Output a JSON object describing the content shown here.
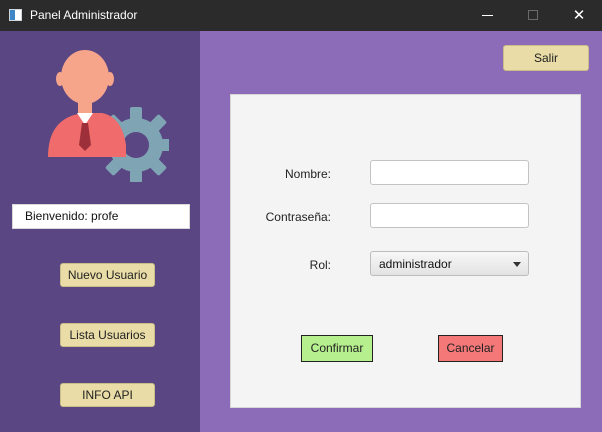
{
  "window": {
    "title": "Panel Administrador",
    "icons": {
      "app": "app-window-icon",
      "minimize": "minimize-icon",
      "maximize": "maximize-icon",
      "close": "close-icon"
    }
  },
  "colors": {
    "sidebar": "#5a4683",
    "main": "#8c6bb8",
    "panel": "#f4f4f4",
    "yellow_button": "#e9dca6",
    "confirm_button": "#b6f08e",
    "cancel_button": "#f57878"
  },
  "sidebar": {
    "avatar_icon": "admin-user-gear-icon",
    "welcome_text": "Bienvenido: profe",
    "buttons": [
      {
        "label": "Nuevo Usuario"
      },
      {
        "label": "Lista Usuarios"
      },
      {
        "label": "INFO API"
      }
    ]
  },
  "main": {
    "logout_label": "Salir",
    "form": {
      "nombre_label": "Nombre:",
      "nombre_value": "",
      "password_label": "Contraseña:",
      "password_value": "",
      "rol_label": "Rol:",
      "rol_selected": "administrador",
      "confirm_label": "Confirmar",
      "cancel_label": "Cancelar"
    }
  }
}
